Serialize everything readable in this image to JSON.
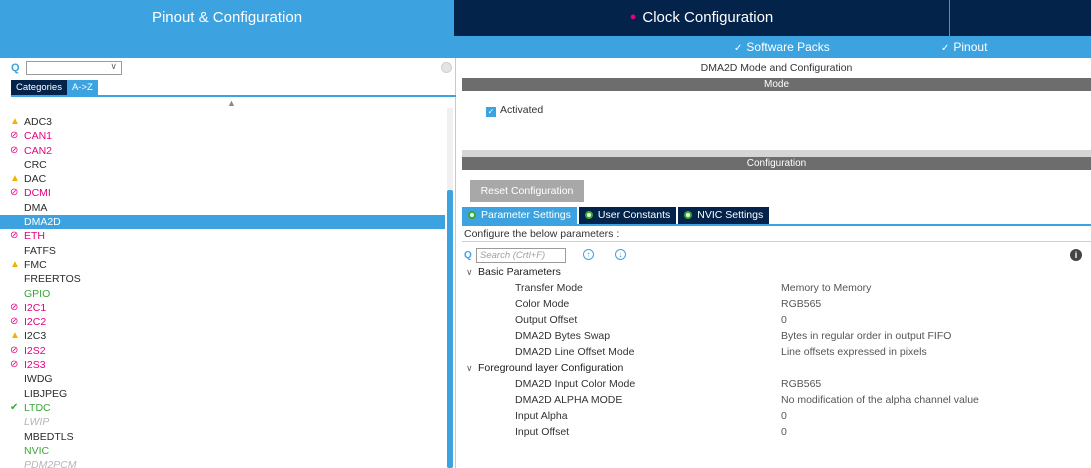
{
  "top_tabs": {
    "pinout": "Pinout & Configuration",
    "clock": "Clock Configuration"
  },
  "subbar": {
    "software_packs": "Software Packs",
    "pinout": "Pinout"
  },
  "left": {
    "search_placeholder": "",
    "tab_categories": "Categories",
    "tab_az": "A->Z",
    "items": [
      {
        "label": "ADC3",
        "status": "warning"
      },
      {
        "label": "CAN1",
        "status": "disabled"
      },
      {
        "label": "CAN2",
        "status": "disabled"
      },
      {
        "label": "CRC",
        "status": "none"
      },
      {
        "label": "DAC",
        "status": "warning"
      },
      {
        "label": "DCMI",
        "status": "disabled"
      },
      {
        "label": "DMA",
        "status": "none"
      },
      {
        "label": "DMA2D",
        "status": "selected"
      },
      {
        "label": "ETH",
        "status": "disabled"
      },
      {
        "label": "FATFS",
        "status": "none"
      },
      {
        "label": "FMC",
        "status": "warning"
      },
      {
        "label": "FREERTOS",
        "status": "none"
      },
      {
        "label": "GPIO",
        "status": "ok"
      },
      {
        "label": "I2C1",
        "status": "disabled"
      },
      {
        "label": "I2C2",
        "status": "disabled"
      },
      {
        "label": "I2C3",
        "status": "warning"
      },
      {
        "label": "I2S2",
        "status": "disabled"
      },
      {
        "label": "I2S3",
        "status": "disabled"
      },
      {
        "label": "IWDG",
        "status": "none"
      },
      {
        "label": "LIBJPEG",
        "status": "none"
      },
      {
        "label": "LTDC",
        "status": "enabled"
      },
      {
        "label": "LWIP",
        "status": "unavailable"
      },
      {
        "label": "MBEDTLS",
        "status": "none"
      },
      {
        "label": "NVIC",
        "status": "ok"
      },
      {
        "label": "PDM2PCM",
        "status": "unavailable"
      }
    ]
  },
  "right": {
    "title": "DMA2D Mode and Configuration",
    "mode_header": "Mode",
    "activated_label": "Activated",
    "activated_checked": true,
    "configuration_header": "Configuration",
    "reset_button": "Reset Configuration",
    "tabs": [
      "Parameter Settings",
      "User Constants",
      "NVIC Settings"
    ],
    "configure_text": "Configure the below parameters :",
    "search_placeholder": "Search (Crtl+F)",
    "groups": [
      {
        "name": "Basic Parameters",
        "params": [
          {
            "name": "Transfer Mode",
            "value": "Memory to Memory"
          },
          {
            "name": "Color Mode",
            "value": "RGB565"
          },
          {
            "name": "Output Offset",
            "value": "0"
          },
          {
            "name": "DMA2D Bytes Swap",
            "value": "Bytes in regular order in output FIFO"
          },
          {
            "name": "DMA2D Line Offset Mode",
            "value": "Line offsets expressed in pixels"
          }
        ]
      },
      {
        "name": "Foreground layer Configuration",
        "params": [
          {
            "name": "DMA2D Input Color Mode",
            "value": "RGB565"
          },
          {
            "name": "DMA2D ALPHA MODE",
            "value": "No modification of the alpha channel value"
          },
          {
            "name": "Input Alpha",
            "value": "0"
          },
          {
            "name": "Input Offset",
            "value": "0"
          }
        ]
      }
    ]
  },
  "colors": {
    "accent_blue": "#3da3e0",
    "navy": "#03234b",
    "pink": "#e6007e",
    "green": "#3aa637",
    "yellow": "#f0b400"
  }
}
